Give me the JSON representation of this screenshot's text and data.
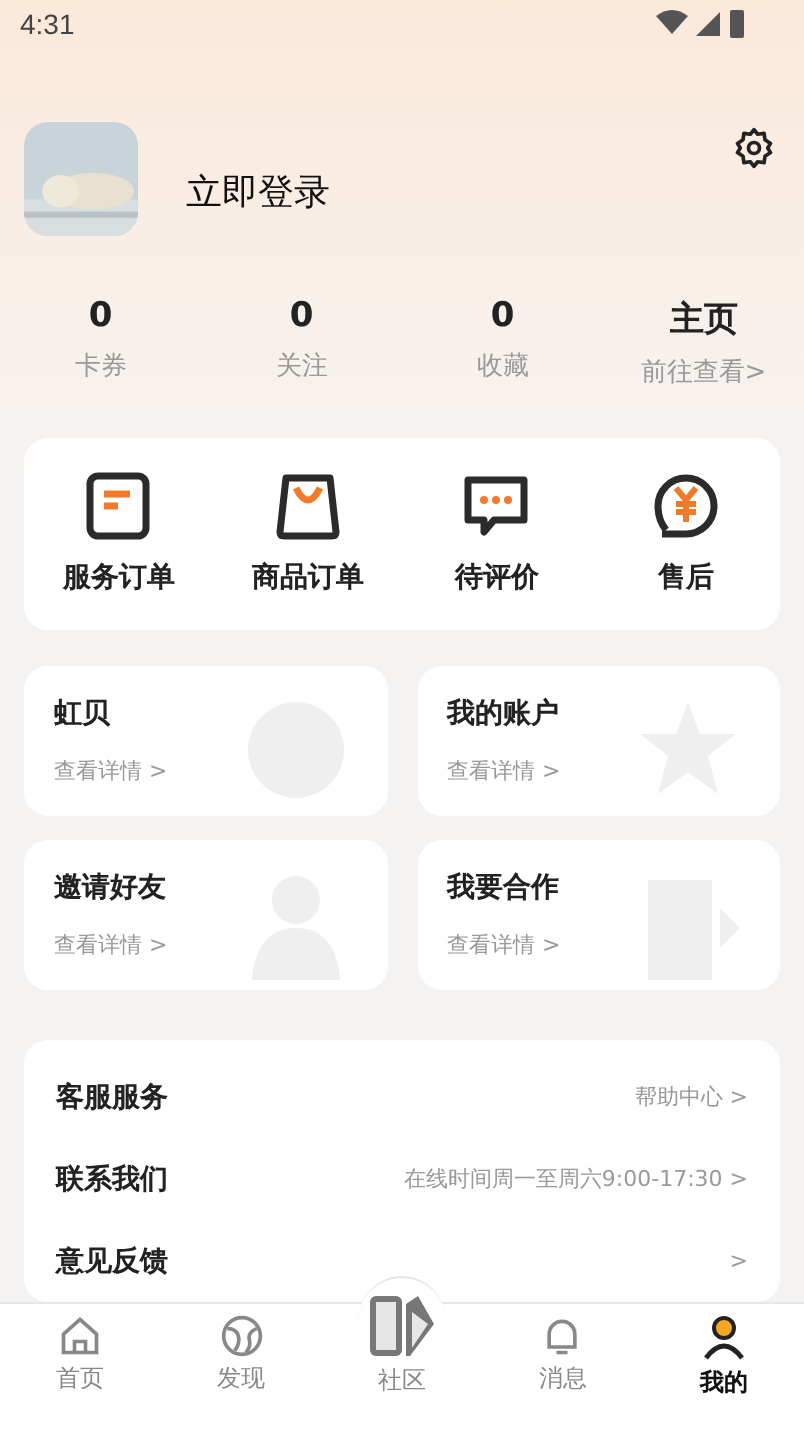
{
  "status_bar": {
    "time": "4:31"
  },
  "profile": {
    "name": "立即登录"
  },
  "stats": [
    {
      "value": "0",
      "label": "卡券"
    },
    {
      "value": "0",
      "label": "关注"
    },
    {
      "value": "0",
      "label": "收藏"
    },
    {
      "value": "主页",
      "label": "前往查看>"
    }
  ],
  "orders": [
    {
      "label": "服务订单"
    },
    {
      "label": "商品订单"
    },
    {
      "label": "待评价"
    },
    {
      "label": "售后"
    }
  ],
  "cards": [
    {
      "title": "虹贝",
      "link": "查看详情 >"
    },
    {
      "title": "我的账户",
      "link": "查看详情 >"
    },
    {
      "title": "邀请好友",
      "link": "查看详情 >"
    },
    {
      "title": "我要合作",
      "link": "查看详情 >"
    }
  ],
  "services": [
    {
      "label": "客服服务",
      "detail": "帮助中心 >"
    },
    {
      "label": "联系我们",
      "detail": "在线时间周一至周六9:00-17:30 >"
    },
    {
      "label": "意见反馈",
      "detail": ">"
    }
  ],
  "tab_bar": [
    {
      "label": "首页",
      "selected": false,
      "kind": "normal"
    },
    {
      "label": "发现",
      "selected": false,
      "kind": "normal"
    },
    {
      "label": "社区",
      "selected": false,
      "kind": "center"
    },
    {
      "label": "消息",
      "selected": false,
      "kind": "normal"
    },
    {
      "label": "我的",
      "selected": true,
      "kind": "normal"
    }
  ]
}
